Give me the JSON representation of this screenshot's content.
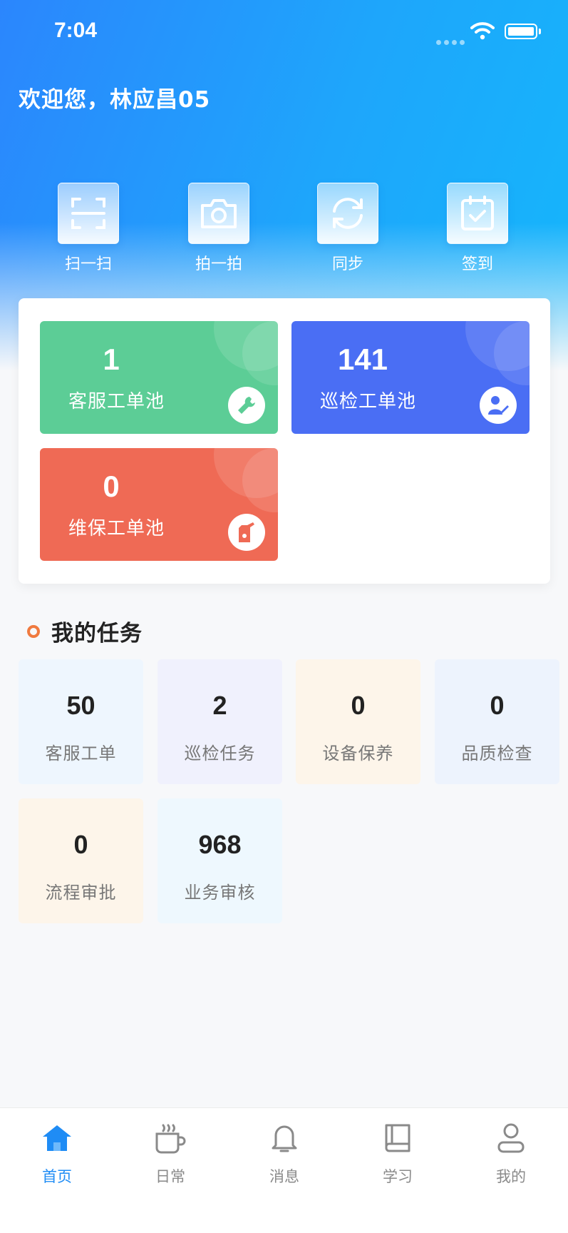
{
  "status": {
    "time": "7:04"
  },
  "header": {
    "welcome": "欢迎您，林应昌05"
  },
  "quick_actions": [
    {
      "label": "扫一扫",
      "icon": "scan-icon"
    },
    {
      "label": "拍一拍",
      "icon": "camera-icon"
    },
    {
      "label": "同步",
      "icon": "sync-icon"
    },
    {
      "label": "签到",
      "icon": "checkin-calendar-icon"
    }
  ],
  "pools": [
    {
      "count": "1",
      "label": "客服工单池",
      "color": "#5ccd96",
      "icon": "wrench-icon"
    },
    {
      "count": "141",
      "label": "巡检工单池",
      "color": "#4a6ef4",
      "icon": "inspector-icon"
    },
    {
      "count": "0",
      "label": "维保工单池",
      "color": "#ef6a55",
      "icon": "oil-can-icon"
    }
  ],
  "tasks": {
    "title": "我的任务",
    "items": [
      {
        "count": "50",
        "label": "客服工单",
        "bg": "#eef6fe"
      },
      {
        "count": "2",
        "label": "巡检任务",
        "bg": "#f0f1fd"
      },
      {
        "count": "0",
        "label": "设备保养",
        "bg": "#fdf5ea"
      },
      {
        "count": "0",
        "label": "品质检查",
        "bg": "#edf3fd"
      },
      {
        "count": "0",
        "label": "流程审批",
        "bg": "#fdf5ea"
      },
      {
        "count": "968",
        "label": "业务审核",
        "bg": "#eef8fe"
      }
    ]
  },
  "tabbar": {
    "items": [
      {
        "label": "首页",
        "icon": "home-icon",
        "active": true
      },
      {
        "label": "日常",
        "icon": "coffee-cup-icon",
        "active": false
      },
      {
        "label": "消息",
        "icon": "bell-icon",
        "active": false
      },
      {
        "label": "学习",
        "icon": "book-icon",
        "active": false
      },
      {
        "label": "我的",
        "icon": "user-icon",
        "active": false
      }
    ]
  },
  "colors": {
    "accent": "#1f8cf5",
    "section_dot": "#f07a3f"
  }
}
